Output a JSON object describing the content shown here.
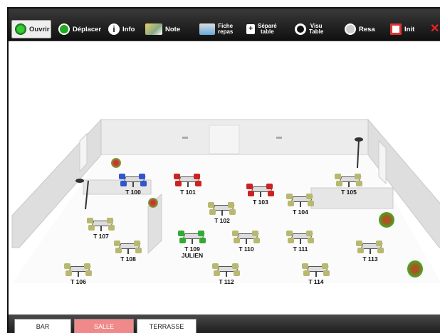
{
  "toolbar": {
    "buttons": [
      {
        "label": "Ouvrir",
        "icon": "green-dot-icon"
      },
      {
        "label": "Déplacer",
        "icon": "move-arrow-icon"
      },
      {
        "label": "Info",
        "icon": "info-icon"
      },
      {
        "label": "Note",
        "icon": "pencil-note-icon"
      },
      {
        "label": "Fiche",
        "label2": "repas",
        "icon": "meal-sheet-icon"
      },
      {
        "label": "Séparé",
        "label2": "table",
        "icon": "split-table-icon"
      },
      {
        "label": "Visu",
        "label2": "Table",
        "icon": "eye-icon"
      },
      {
        "label": "Resa",
        "icon": "alarm-clock-icon"
      },
      {
        "label": "Init",
        "icon": "reset-icon"
      }
    ]
  },
  "tables": [
    {
      "id": "T 100",
      "color": "#3355cc"
    },
    {
      "id": "T 101",
      "color": "#cc2222"
    },
    {
      "id": "T 102",
      "color": "#b8b870"
    },
    {
      "id": "T 103",
      "color": "#cc2222"
    },
    {
      "id": "T 104",
      "color": "#b8b870"
    },
    {
      "id": "T 105",
      "color": "#b8b870"
    },
    {
      "id": "T 106",
      "color": "#b8b870"
    },
    {
      "id": "T 107",
      "color": "#b8b870"
    },
    {
      "id": "T 108",
      "color": "#b8b870"
    },
    {
      "id": "T 109",
      "sub": "JULIEN",
      "color": "#33aa33"
    },
    {
      "id": "T 110",
      "color": "#b8b870"
    },
    {
      "id": "T 111",
      "color": "#b8b870"
    },
    {
      "id": "T 112",
      "color": "#b8b870"
    },
    {
      "id": "T 113",
      "color": "#b8b870"
    },
    {
      "id": "T 114",
      "color": "#b8b870"
    }
  ],
  "tabs": [
    {
      "label": "BAR",
      "active": false
    },
    {
      "label": "SALLE",
      "active": true
    },
    {
      "label": "TERRASSE",
      "active": false
    }
  ]
}
